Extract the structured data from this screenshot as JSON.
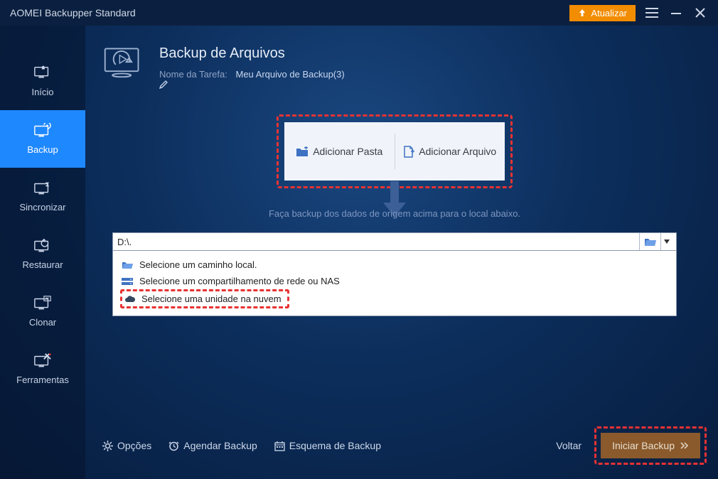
{
  "titlebar": {
    "app_title": "AOMEI Backupper Standard",
    "upgrade_label": "Atualizar"
  },
  "sidebar": {
    "items": [
      {
        "label": "Início"
      },
      {
        "label": "Backup"
      },
      {
        "label": "Sincronizar"
      },
      {
        "label": "Restaurar"
      },
      {
        "label": "Clonar"
      },
      {
        "label": "Ferramentas"
      }
    ]
  },
  "page": {
    "title": "Backup de Arquivos",
    "task_label": "Nome da Tarefa:",
    "task_name": "Meu Arquivo de Backup(3)"
  },
  "source": {
    "add_folder": "Adicionar Pasta",
    "add_file": "Adicionar Arquivo",
    "hint": "Faça backup dos dados de origem acima para o local abaixo."
  },
  "destination": {
    "path": "D:\\.",
    "options": {
      "local": "Selecione um caminho local.",
      "nas": "Selecione um compartilhamento de rede ou NAS",
      "cloud": "Selecione uma unidade na nuvem"
    }
  },
  "footer": {
    "options": "Opções",
    "schedule": "Agendar Backup",
    "scheme": "Esquema de Backup",
    "back": "Voltar",
    "start": "Iniciar Backup"
  }
}
